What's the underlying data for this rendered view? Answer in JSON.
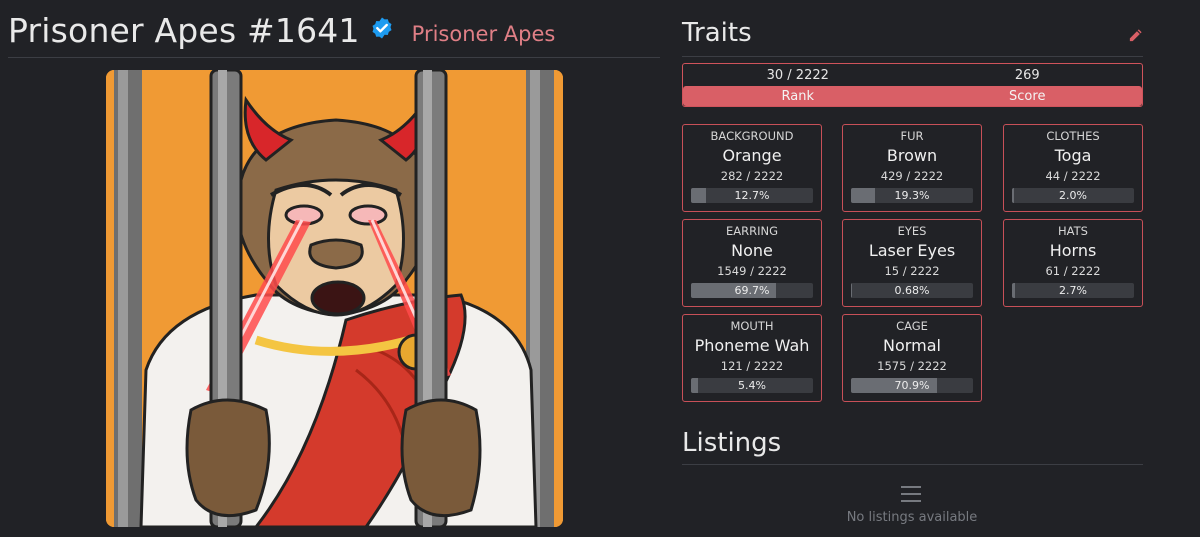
{
  "header": {
    "title": "Prisoner Apes #1641",
    "collection": "Prisoner Apes"
  },
  "traits_section": {
    "title": "Traits",
    "rank_value": "30 / 2222",
    "score_value": "269",
    "rank_label": "Rank",
    "score_label": "Score"
  },
  "traits": [
    {
      "type": "BACKGROUND",
      "value": "Orange",
      "count": "282 / 2222",
      "percent": "12.7%",
      "fraction": 0.127
    },
    {
      "type": "FUR",
      "value": "Brown",
      "count": "429 / 2222",
      "percent": "19.3%",
      "fraction": 0.193
    },
    {
      "type": "CLOTHES",
      "value": "Toga",
      "count": "44 / 2222",
      "percent": "2.0%",
      "fraction": 0.02
    },
    {
      "type": "EARRING",
      "value": "None",
      "count": "1549 / 2222",
      "percent": "69.7%",
      "fraction": 0.697
    },
    {
      "type": "EYES",
      "value": "Laser Eyes",
      "count": "15 / 2222",
      "percent": "0.68%",
      "fraction": 0.0068
    },
    {
      "type": "HATS",
      "value": "Horns",
      "count": "61 / 2222",
      "percent": "2.7%",
      "fraction": 0.027
    },
    {
      "type": "MOUTH",
      "value": "Phoneme Wah",
      "count": "121 / 2222",
      "percent": "5.4%",
      "fraction": 0.054
    },
    {
      "type": "CAGE",
      "value": "Normal",
      "count": "1575 / 2222",
      "percent": "70.9%",
      "fraction": 0.709
    }
  ],
  "listings_section": {
    "title": "Listings",
    "empty_text": "No listings available"
  },
  "icons": {
    "verified": "verified-badge-icon",
    "edit": "pencil-icon",
    "empty": "list-icon"
  },
  "colors": {
    "accent": "#d95f66",
    "verified": "#1d9bf0",
    "background": "#212226"
  }
}
